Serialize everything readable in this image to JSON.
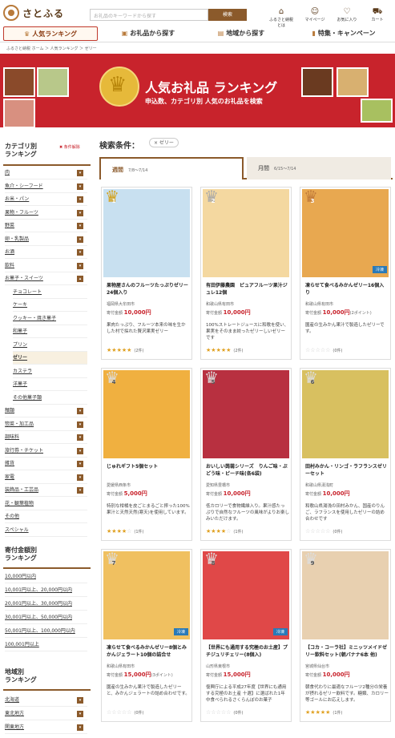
{
  "header": {
    "logo_text": "さとふる",
    "search_placeholder": "お礼品のキーワードから探す",
    "search_button": "検索",
    "icons": [
      {
        "label": "ふるさと納税とは",
        "icon": "building-icon"
      },
      {
        "label": "マイページ",
        "icon": "user-icon"
      },
      {
        "label": "お気に入り",
        "icon": "heart-icon"
      },
      {
        "label": "カート",
        "icon": "cart-icon"
      }
    ]
  },
  "nav": [
    {
      "label": "人気ランキング",
      "icon": "crown-icon"
    },
    {
      "label": "お礼品から探す",
      "icon": "gift-icon"
    },
    {
      "label": "地域から探す",
      "icon": "map-icon"
    },
    {
      "label": "特集・キャンペーン",
      "icon": "bookmark-icon"
    }
  ],
  "breadcrumb": "ふるさと納税 ホーム ＞ 人気ランキング ＞ ゼリー",
  "banner": {
    "title": "人気お礼品 ランキング",
    "subtitle": "申込数、カテゴリ別 人気のお礼品を検索"
  },
  "sidebar": {
    "category_title": "カテゴリ別\nランキング",
    "condition_clear": "条件解除",
    "categories": [
      {
        "label": "肉",
        "box": "▾"
      },
      {
        "label": "魚介・シーフード",
        "box": "▾"
      },
      {
        "label": "お米・パン",
        "box": "▾"
      },
      {
        "label": "果物・フルーツ",
        "box": "▾"
      },
      {
        "label": "野菜",
        "box": "▾"
      },
      {
        "label": "卵・乳製品",
        "box": "▾"
      },
      {
        "label": "お酒",
        "box": "▾"
      },
      {
        "label": "飲料",
        "box": "▾"
      },
      {
        "label": "お菓子・スイーツ",
        "box": "▴"
      }
    ],
    "subcategories": [
      {
        "label": "チョコレート"
      },
      {
        "label": "ケーキ"
      },
      {
        "label": "クッキー・焼き菓子"
      },
      {
        "label": "和菓子"
      },
      {
        "label": "プリン"
      },
      {
        "label": "ゼリー",
        "selected": true
      },
      {
        "label": "カステラ"
      },
      {
        "label": "洋菓子"
      },
      {
        "label": "その他菓子類"
      }
    ],
    "categories2": [
      {
        "label": "麺類",
        "box": "▾"
      },
      {
        "label": "惣菜・加工品",
        "box": "▾"
      },
      {
        "label": "調味料",
        "box": "▾"
      },
      {
        "label": "旅行券・チケット",
        "box": "▾"
      },
      {
        "label": "雑貨",
        "box": "▾"
      },
      {
        "label": "家電",
        "box": "▾"
      },
      {
        "label": "装飾品・工芸品",
        "box": "▾"
      },
      {
        "label": "花・観葉植物",
        "box": ""
      },
      {
        "label": "その他",
        "box": ""
      },
      {
        "label": "スペシャル",
        "box": ""
      }
    ],
    "donation_title": "寄付金額別\nランキング",
    "donations": [
      "10,000円以内",
      "10,001円以上、20,000円以内",
      "20,001円以上、30,000円以内",
      "30,001円以上、50,000円以内",
      "50,001円以上、100,000円以内",
      "100,001円以上"
    ],
    "region_title": "地域別\nランキング",
    "regions": [
      {
        "label": "北海道",
        "box": "▾"
      },
      {
        "label": "東北地方",
        "box": "▾"
      },
      {
        "label": "関東地方",
        "box": "▾"
      }
    ]
  },
  "main": {
    "condition_label": "検索条件：",
    "condition_tag": "× ゼリー",
    "tabs": [
      {
        "label": "週間",
        "range": "7/8〜7/14"
      },
      {
        "label": "月間",
        "range": "6/15〜7/14"
      }
    ],
    "price_label": "寄付金額",
    "items": [
      {
        "rank": "1",
        "title": "果物屋さんのフルーツたっぷりゼリー24個入り",
        "city": "福岡県大牟田市",
        "price": "10,000円",
        "points": "",
        "desc": "果肉たっぷり、フルーツ本来の味を生かした村で採れた贅沢果実ゼリー",
        "rating": 4.5,
        "count": "(2件)",
        "cool": false
      },
      {
        "rank": "2",
        "title": "有田伊藤農園　ピュアフルーツ果汁ジュレ12個",
        "city": "和歌山県有田市",
        "price": "10,000円",
        "points": "",
        "desc": "100%ストレートジュースに和歌を使い、果実をそのまま絞ったゼリーしいゼリーです",
        "rating": 5,
        "count": "(2件)",
        "cool": false
      },
      {
        "rank": "3",
        "title": "凍らせて食べるみかんゼリー16個入り",
        "city": "和歌山県有田市",
        "price": "10,000円",
        "points": "(2ポイント)",
        "desc": "園産の生みかん果汁で製造したゼリーです。",
        "rating": 0,
        "count": "(0件)",
        "cool": true
      },
      {
        "rank": "4",
        "title": "じゅれギフト5個セット",
        "city": "愛媛県西条市",
        "price": "5,000円",
        "points": "",
        "desc": "特別な柑橘を皮ごとまるごと搾った100%果汁と天然天然(寒天)を使用しています。",
        "rating": 4,
        "count": "(1件)",
        "cool": false
      },
      {
        "rank": "5",
        "title": "おいしい蒟蒻シリーズ　りんご味・ぶどう味・ピーチ味(各6袋)",
        "city": "愛知県豊橋市",
        "price": "10,000円",
        "points": "",
        "desc": "低カロリーで食物繊維入り。果汁感たっぷりで自然なフルーツの風味がよりお楽しみいただけます。",
        "rating": 4,
        "count": "(1件)",
        "cool": false
      },
      {
        "rank": "6",
        "title": "田村みかん・リンゴ・ラフランスゼリーセット",
        "city": "和歌山県湯浅町",
        "price": "10,000円",
        "points": "",
        "desc": "和歌山県湯浅の田村みかん、国産のりんご、ラフランスを使用したゼリーの詰め合わせです",
        "rating": 0,
        "count": "(0件)",
        "cool": false
      },
      {
        "rank": "7",
        "title": "凍らせて食べるみかんゼリー8個とみかんジェラート10個の詰合せ",
        "city": "和歌山県有田市",
        "price": "15,000円",
        "points": "(3ポイント)",
        "desc": "園産の生みかん果汁で製造したゼリーと、みかんジェラートの詰め合わせです。",
        "rating": 0,
        "count": "(0件)",
        "cool": true
      },
      {
        "rank": "8",
        "title": "【世界にも通用する究極のお土産】プチジュリチェリー(8個入)",
        "city": "山形県東根市",
        "price": "15,000円",
        "points": "",
        "desc": "復興庁による平成27年度【世界にも通用する究極のお土産 十選】に選ばれた1年中食べられるさくらんぼのお菓子",
        "rating": 0,
        "count": "(0件)",
        "cool": true
      },
      {
        "rank": "9",
        "title": "【コカ・コーラ社】ミニッツメイドゼリー飲料セット(朝バナナ6本 他)",
        "city": "宮城県仙台市",
        "price": "10,000円",
        "points": "",
        "desc": "朝食代わりに最適なフルーツ2種分の栄養が摂れるゼリー飲料です。糖類、カロリー等ゴールにお応えします。",
        "rating": 5,
        "count": "(1件)",
        "cool": false
      }
    ]
  },
  "colors": {
    "brand": "#8b5a2b",
    "banner": "#c8232c",
    "price": "#c8232c",
    "gold": "#d4a017",
    "silver": "#a8a8a8",
    "bronze": "#c07a3a",
    "cool": "#2a7ab8"
  }
}
